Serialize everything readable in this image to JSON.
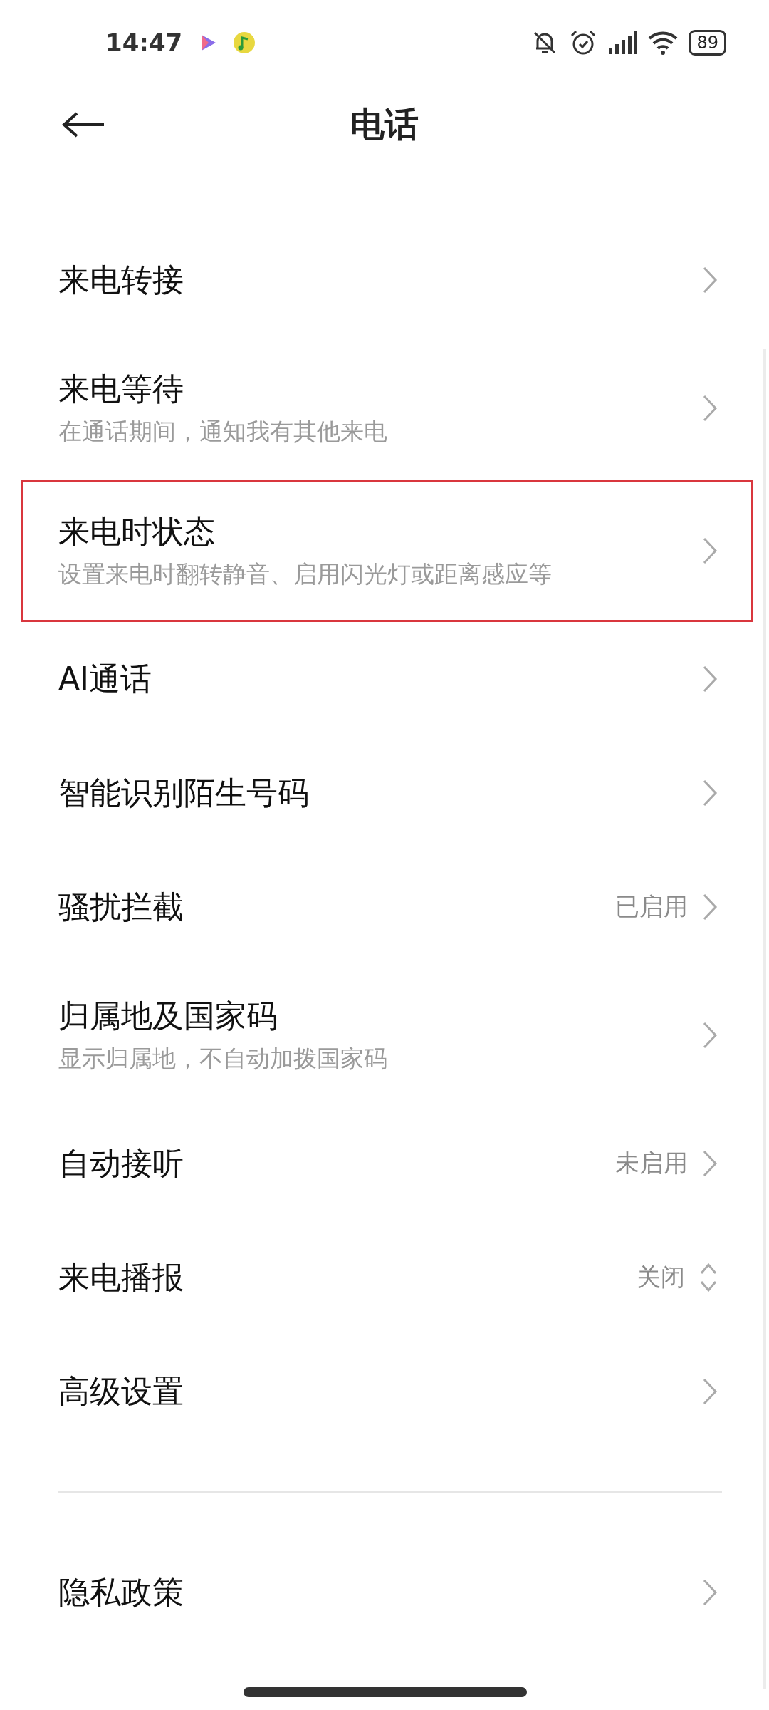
{
  "status_bar": {
    "time": "14:47",
    "battery": "89"
  },
  "header": {
    "title": "电话"
  },
  "items": [
    {
      "kind": "link",
      "title": "来电转接",
      "highlighted": false
    },
    {
      "kind": "link",
      "title": "来电等待",
      "subtitle": "在通话期间，通知我有其他来电",
      "highlighted": false
    },
    {
      "kind": "link",
      "title": "来电时状态",
      "subtitle": "设置来电时翻转静音、启用闪光灯或距离感应等",
      "highlighted": true
    },
    {
      "kind": "link",
      "title": "AI通话",
      "highlighted": false
    },
    {
      "kind": "link",
      "title": "智能识别陌生号码",
      "highlighted": false
    },
    {
      "kind": "link",
      "title": "骚扰拦截",
      "value": "已启用",
      "highlighted": false
    },
    {
      "kind": "link",
      "title": "归属地及国家码",
      "subtitle": "显示归属地，不自动加拨国家码",
      "highlighted": false
    },
    {
      "kind": "link",
      "title": "自动接听",
      "value": "未启用",
      "highlighted": false
    },
    {
      "kind": "select",
      "title": "来电播报",
      "value": "关闭",
      "highlighted": false
    },
    {
      "kind": "link",
      "title": "高级设置",
      "highlighted": false
    }
  ],
  "footer_items": [
    {
      "kind": "link",
      "title": "隐私政策",
      "highlighted": false
    }
  ]
}
